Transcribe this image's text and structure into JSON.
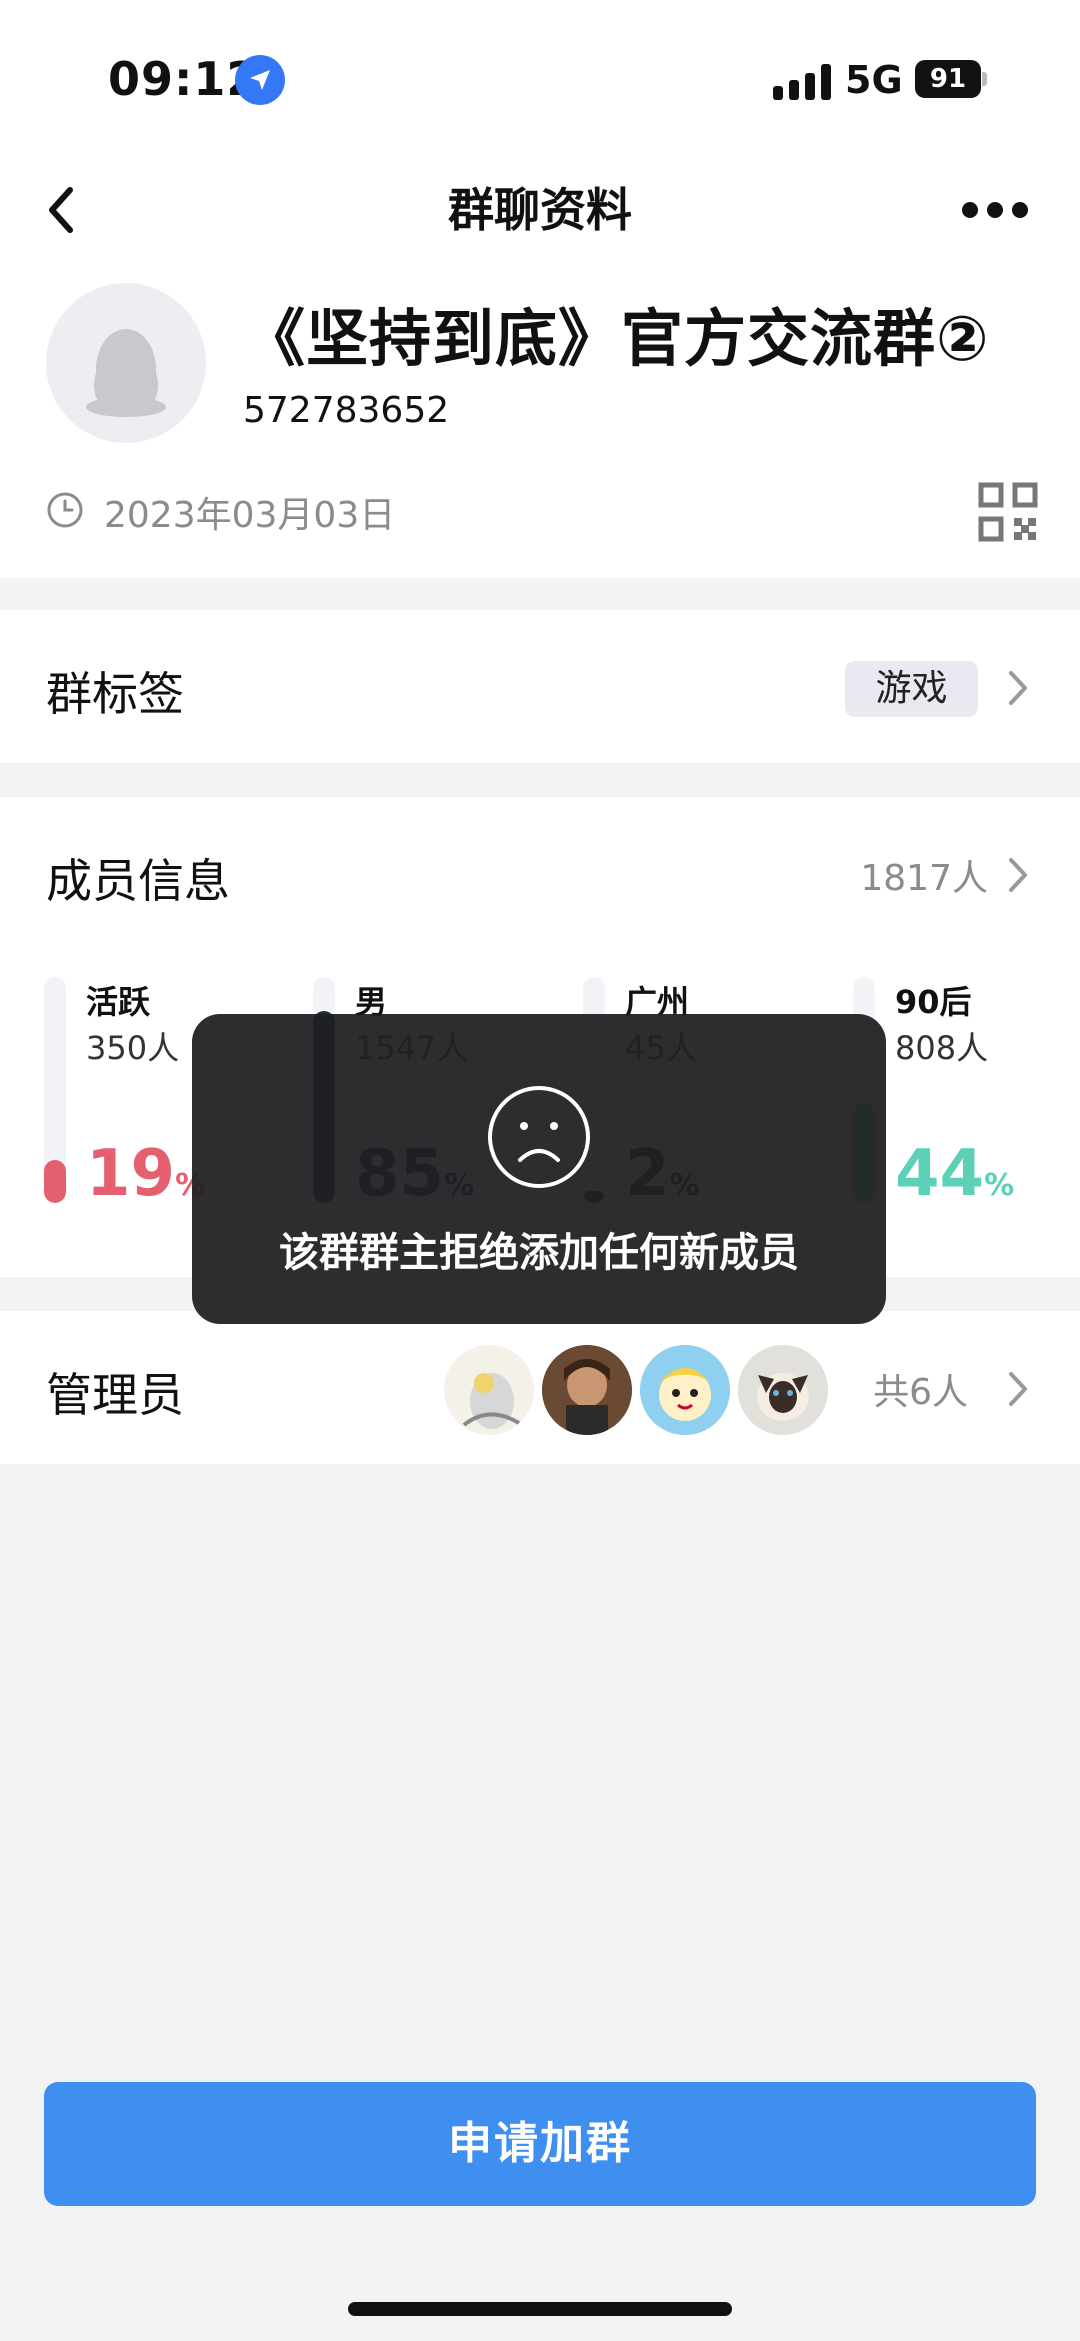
{
  "status_bar": {
    "time": "09:12",
    "network": "5G",
    "battery": "91"
  },
  "header": {
    "title": "群聊资料"
  },
  "profile": {
    "group_name": "《坚持到底》官方交流群②",
    "group_id": "572783652",
    "created_date": "2023年03月03日"
  },
  "tags": {
    "label": "群标签",
    "tag": "游戏"
  },
  "members": {
    "label": "成员信息",
    "count": "1817人",
    "stats": [
      {
        "label": "活跃",
        "count": "350人",
        "percent": "19",
        "unit": "%",
        "fill": 0.19,
        "color": "#e5606e"
      },
      {
        "label": "男",
        "count": "1547人",
        "percent": "85",
        "unit": "%",
        "fill": 0.85,
        "color": "#1e2b4a"
      },
      {
        "label": "广州",
        "count": "45人",
        "percent": "2",
        "unit": "%",
        "fill": 0.02,
        "color": "#222222"
      },
      {
        "label": "90后",
        "count": "808人",
        "percent": "44",
        "unit": "%",
        "fill": 0.44,
        "color": "#5dd0b8"
      }
    ]
  },
  "admins": {
    "label": "管理员",
    "total": "共6人"
  },
  "toast": {
    "message": "该群群主拒绝添加任何新成员"
  },
  "join_button": {
    "label": "申请加群"
  }
}
